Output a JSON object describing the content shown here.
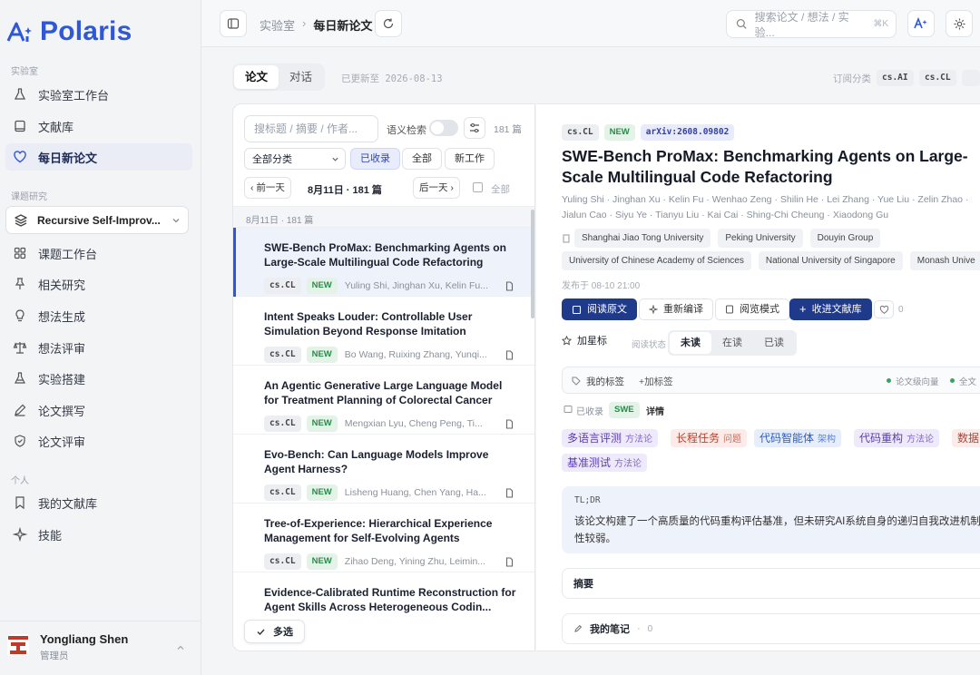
{
  "app": {
    "logo_text": "Polaris"
  },
  "sidebar": {
    "section_lab": "实验室",
    "lab_items": [
      {
        "label": "实验室工作台",
        "icon": "flask-icon"
      },
      {
        "label": "文献库",
        "icon": "book-icon"
      },
      {
        "label": "每日新论文",
        "icon": "heart-icon",
        "active": true
      }
    ],
    "section_research": "课题研究",
    "project_name": "Recursive Self-Improv...",
    "research_items": [
      {
        "label": "课题工作台",
        "icon": "grid-icon"
      },
      {
        "label": "相关研究",
        "icon": "pin-icon"
      },
      {
        "label": "想法生成",
        "icon": "bulb-icon"
      },
      {
        "label": "想法评审",
        "icon": "scale-icon"
      },
      {
        "label": "实验搭建",
        "icon": "beaker-icon"
      },
      {
        "label": "论文撰写",
        "icon": "pen-icon"
      },
      {
        "label": "论文评审",
        "icon": "shield-icon"
      }
    ],
    "section_personal": "个人",
    "personal_items": [
      {
        "label": "我的文献库",
        "icon": "bookmark-icon"
      },
      {
        "label": "技能",
        "icon": "sparkle-icon"
      }
    ],
    "user": {
      "name": "Yongliang Shen",
      "role": "管理员"
    }
  },
  "topbar": {
    "breadcrumb_parent": "实验室",
    "breadcrumb_sep": "›",
    "breadcrumb_current": "每日新论文",
    "search_placeholder": "搜索论文 / 想法 / 实验...",
    "search_shortcut": "⌘K"
  },
  "main": {
    "tabs": [
      "论文",
      "对话"
    ],
    "updated": "已更新至 2026-08-13",
    "subscribed_label": "订阅分类",
    "subscribed": [
      "cs.AI",
      "cs.CL"
    ]
  },
  "list": {
    "search_placeholder": "搜标题 / 摘要 / 作者...",
    "semantic_label": "语义检索",
    "count": "181 篇",
    "category_select": "全部分类",
    "filters": [
      "已收录",
      "全部",
      "新工作"
    ],
    "prev_day": "‹ 前一天",
    "date_label": "8月11日 · 181 篇",
    "next_day": "后一天 ›",
    "all_label": "全部",
    "group_header": "8月11日 · 181 篇",
    "multi_select": "多选",
    "items": [
      {
        "title": "SWE-Bench ProMax: Benchmarking Agents on Large-Scale Multilingual Code Refactoring",
        "cat": "cs.CL",
        "badge": "NEW",
        "authors": "Yuling Shi, Jinghan Xu, Kelin Fu...",
        "active": true
      },
      {
        "title": "Intent Speaks Louder: Controllable User Simulation Beyond Response Imitation",
        "cat": "cs.CL",
        "badge": "NEW",
        "authors": "Bo Wang, Ruixing Zhang, Yunqi..."
      },
      {
        "title": "An Agentic Generative Large Language Model for Treatment Planning of Colorectal Cancer",
        "cat": "cs.CL",
        "badge": "NEW",
        "authors": "Mengxian Lyu, Cheng Peng, Ti..."
      },
      {
        "title": "Evo-Bench: Can Language Models Improve Agent Harness?",
        "cat": "cs.CL",
        "badge": "NEW",
        "authors": "Lisheng Huang, Chen Yang, Ha..."
      },
      {
        "title": "Tree-of-Experience: Hierarchical Experience Management for Self-Evolving Agents",
        "cat": "cs.CL",
        "badge": "NEW",
        "authors": "Zihao Deng, Yining Zhu, Leimin..."
      },
      {
        "title": "Evidence-Calibrated Runtime Reconstruction for Agent Skills Across Heterogeneous Codin...",
        "cat": "",
        "badge": "",
        "authors": ""
      }
    ]
  },
  "detail": {
    "cat": "cs.CL",
    "badge": "NEW",
    "arxiv": "arXiv:2608.09802",
    "title": "SWE-Bench ProMax: Benchmarking Agents on Large-Scale Multilingual Code Refactoring",
    "authors_line1": "Yuling Shi · Jinghan Xu · Kelin Fu · Wenhao Zeng · Shilin He · Lei Zhang · Yue Liu · Zelin Zhao ·",
    "authors_line2": "Jialun Cao · Siyu Ye · Tianyu Liu · Kai Cai · Shing-Chi Cheung · Xiaodong Gu",
    "affiliations_row1": [
      "Shanghai Jiao Tong University",
      "Peking University",
      "Douyin Group"
    ],
    "affiliations_row2": [
      "University of Chinese Academy of Sciences",
      "National University of Singapore",
      "Monash Unive"
    ],
    "published": "发布于 08-10 21:00",
    "actions": {
      "read": "阅读原文",
      "recompile": "重新编译",
      "reader": "阅览模式",
      "collect": "收进文献库",
      "likes": "0"
    },
    "star": "加星标",
    "read_status_label": "阅读状态",
    "read_status": [
      "未读",
      "在读",
      "已读"
    ],
    "my_tags": "我的标签",
    "add_tag": "+加标签",
    "vector_label": "论文级向量",
    "fulltext_label": "全文",
    "collected": "已收录",
    "swe_chip": "SWE",
    "details": "详情",
    "tags": [
      {
        "name": "多语言评测",
        "kind": "方法论",
        "style": "purple"
      },
      {
        "name": "长程任务",
        "kind": "问题",
        "style": "red"
      },
      {
        "name": "代码智能体",
        "kind": "架构",
        "style": "blue"
      },
      {
        "name": "代码重构",
        "kind": "方法论",
        "style": "purple"
      },
      {
        "name": "数据",
        "kind": "",
        "style": "red"
      },
      {
        "name": "基准测试",
        "kind": "方法论",
        "style": "purple"
      }
    ],
    "tldr_label": "TL;DR",
    "tldr_line1": "该论文构建了一个高质量的代码重构评估基准，但未研究AI系统自身的递归自我改进机制，与",
    "tldr_line2": "性较弱。",
    "abstract_label": "摘要",
    "notes_label": "我的笔记",
    "notes_count": "0"
  }
}
